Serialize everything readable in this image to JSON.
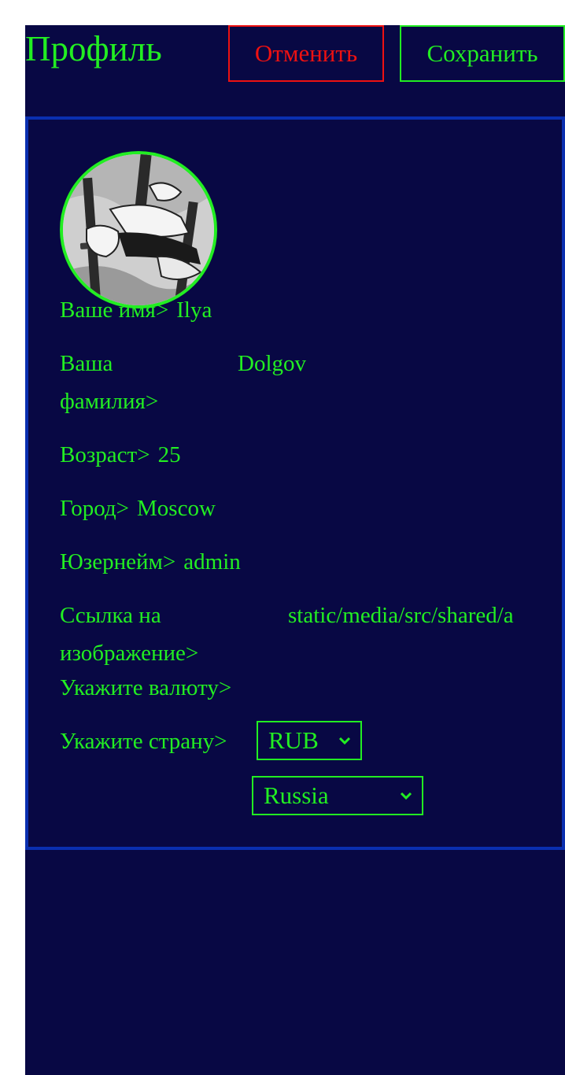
{
  "header": {
    "title": "Профиль",
    "cancel_label": "Отменить",
    "save_label": "Сохранить"
  },
  "profile": {
    "avatar_icon": "avatar-manga-swords-icon",
    "fields": [
      {
        "label": "Ваше имя>",
        "value": "Ilya"
      },
      {
        "label": "Ваша фамилия>",
        "value": "Dolgov"
      },
      {
        "label": "Возраст>",
        "value": "25"
      },
      {
        "label": "Город>",
        "value": "Moscow"
      },
      {
        "label": "Юзернейм>",
        "value": "admin"
      },
      {
        "label": "Ссылка на изображение>",
        "value": "static/media/src/shared/a"
      }
    ],
    "currency": {
      "label": "Укажите валюту>",
      "selected": "RUB"
    },
    "country": {
      "label": "Укажите страну>",
      "selected": "Russia"
    }
  },
  "colors": {
    "background": "#080844",
    "accent": "#22ee22",
    "danger": "#ee1111",
    "card_border": "#0a2fb0"
  }
}
